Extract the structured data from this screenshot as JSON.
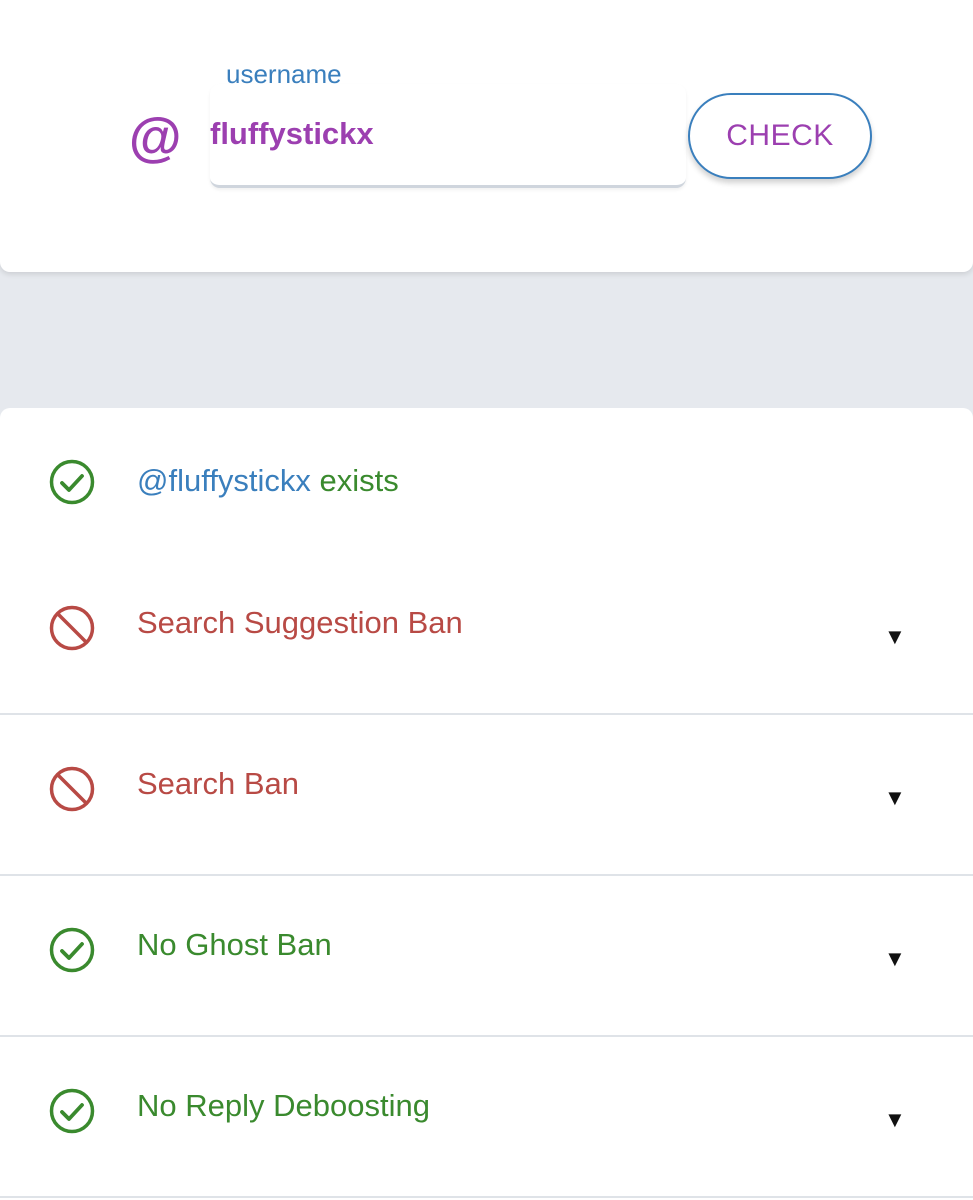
{
  "search": {
    "at_symbol": "@",
    "label": "username",
    "value": "fluffystickx",
    "button_label": "CHECK"
  },
  "results": {
    "exists": {
      "handle": "@fluffystickx",
      "suffix": " exists",
      "status": "ok"
    },
    "items": [
      {
        "label": "Search Suggestion Ban",
        "status": "banned",
        "expand": "▼"
      },
      {
        "label": "Search Ban",
        "status": "banned",
        "expand": "▼"
      },
      {
        "label": "No Ghost Ban",
        "status": "ok",
        "expand": "▼"
      },
      {
        "label": "No Reply Deboosting",
        "status": "ok",
        "expand": "▼"
      }
    ]
  },
  "colors": {
    "accent_purple": "#9c3fb0",
    "accent_blue": "#3a7fbd",
    "ok_green": "#3a8a2e",
    "ban_red": "#b84a45",
    "background": "#e6e9ee"
  },
  "icons": {
    "ok": "check-circle-icon",
    "banned": "prohibited-icon",
    "expand": "caret-down-icon"
  }
}
